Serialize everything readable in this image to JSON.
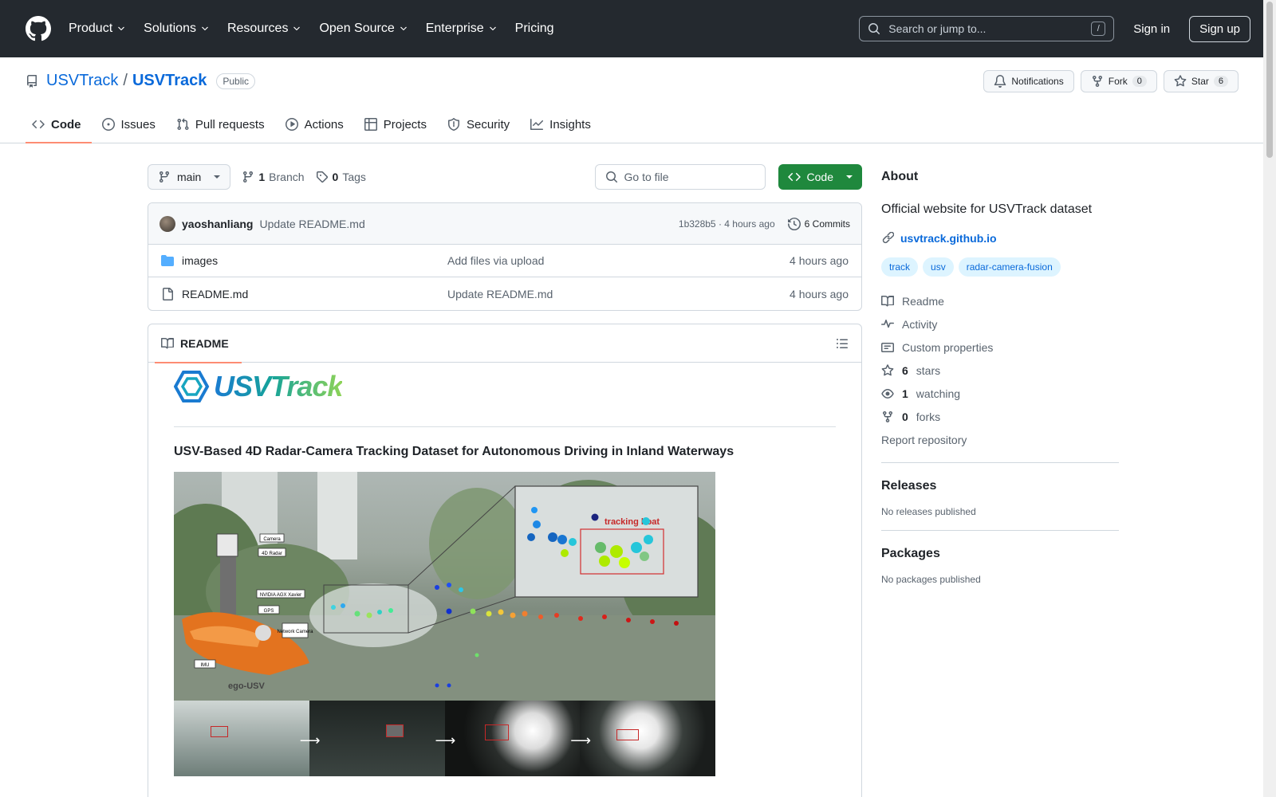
{
  "header": {
    "nav": [
      "Product",
      "Solutions",
      "Resources",
      "Open Source",
      "Enterprise"
    ],
    "pricing": "Pricing",
    "search_placeholder": "Search or jump to...",
    "search_key": "/",
    "signin": "Sign in",
    "signup": "Sign up"
  },
  "repo": {
    "owner": "USVTrack",
    "sep": "/",
    "name": "USVTrack",
    "visibility": "Public",
    "notifications": "Notifications",
    "fork_label": "Fork",
    "fork_count": "0",
    "star_label": "Star",
    "star_count": "6",
    "tabs": [
      "Code",
      "Issues",
      "Pull requests",
      "Actions",
      "Projects",
      "Security",
      "Insights"
    ]
  },
  "filebar": {
    "branch": "main",
    "branch_count": "1",
    "branch_label": "Branch",
    "tag_count": "0",
    "tag_label": "Tags",
    "goto_placeholder": "Go to file",
    "code_label": "Code"
  },
  "commit": {
    "author": "yaoshanliang",
    "message": "Update README.md",
    "hash_time": "1b328b5 · 4 hours ago",
    "commits": "6 Commits"
  },
  "files": [
    {
      "name": "images",
      "commit": "Add files via upload",
      "time": "4 hours ago",
      "type": "folder"
    },
    {
      "name": "README.md",
      "commit": "Update README.md",
      "time": "4 hours ago",
      "type": "file"
    }
  ],
  "readme": {
    "tab": "README",
    "logo_text": "USVTrack",
    "heading": "USV-Based 4D Radar-Camera Tracking Dataset for Autonomous Driving in Inland Waterways",
    "figure": {
      "labels": [
        "Camera",
        "4D Radar",
        "NVIDIA AGX Xavier",
        "GPS",
        "Network Camera",
        "IMU"
      ],
      "ego": "ego-USV",
      "tracking": "tracking boat"
    }
  },
  "about": {
    "title": "About",
    "description": "Official website for USVTrack dataset",
    "link": "usvtrack.github.io",
    "topics": [
      "track",
      "usv",
      "radar-camera-fusion"
    ],
    "items": [
      {
        "icon": "book-icon",
        "bold": "",
        "text": "Readme"
      },
      {
        "icon": "pulse-icon",
        "bold": "",
        "text": "Activity"
      },
      {
        "icon": "note-icon",
        "bold": "",
        "text": "Custom properties"
      },
      {
        "icon": "star-icon",
        "bold": "6",
        "text": "stars"
      },
      {
        "icon": "eye-icon",
        "bold": "1",
        "text": "watching"
      },
      {
        "icon": "fork-icon",
        "bold": "0",
        "text": "forks"
      }
    ],
    "report": "Report repository"
  },
  "releases": {
    "title": "Releases",
    "text": "No releases published"
  },
  "packages": {
    "title": "Packages",
    "text": "No packages published"
  }
}
